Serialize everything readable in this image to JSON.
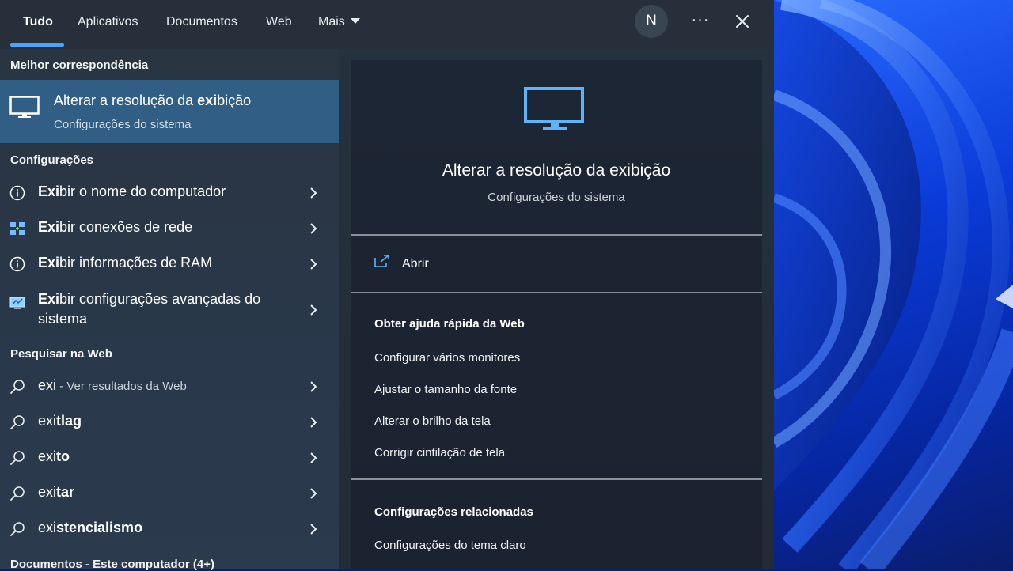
{
  "tabs": [
    {
      "label": "Tudo"
    },
    {
      "label": "Aplicativos"
    },
    {
      "label": "Documentos"
    },
    {
      "label": "Web"
    },
    {
      "label": "Mais"
    }
  ],
  "avatar_initial": "N",
  "more_label": "···",
  "sections": {
    "best_match": "Melhor correspondência",
    "settings": "Configurações",
    "web_search": "Pesquisar na Web",
    "documents": "Documentos - Este computador (4+)"
  },
  "best_match": {
    "title_pre": "Alterar a resolução da ",
    "title_bold": "exi",
    "title_post": "bição",
    "subtitle": "Configurações do sistema"
  },
  "settings_items": [
    {
      "bold": "Exi",
      "rest": "bir o nome do computador",
      "icon": "info-icon"
    },
    {
      "bold": "Exi",
      "rest": "bir conexões de rede",
      "icon": "network-icon"
    },
    {
      "bold": "Exi",
      "rest": "bir informações de RAM",
      "icon": "info-icon"
    },
    {
      "bold": "Exi",
      "rest": "bir configurações avançadas do sistema",
      "icon": "computer-icon"
    }
  ],
  "web_items": [
    {
      "pre": "exi",
      "bold": "",
      "muted": " - Ver resultados da Web"
    },
    {
      "pre": "exi",
      "bold": "tlag",
      "muted": ""
    },
    {
      "pre": "exi",
      "bold": "to",
      "muted": ""
    },
    {
      "pre": "exi",
      "bold": "tar",
      "muted": ""
    },
    {
      "pre": "exi",
      "bold": "stencialismo",
      "muted": ""
    }
  ],
  "detail": {
    "title": "Alterar a resolução da exibição",
    "subtitle": "Configurações do sistema",
    "open_label": "Abrir",
    "help_heading": "Obter ajuda rápida da Web",
    "help_links": [
      "Configurar vários monitores",
      "Ajustar o tamanho da fonte",
      "Alterar o brilho da tela",
      "Corrigir cintilação de tela"
    ],
    "related_heading": "Configurações relacionadas",
    "related_links": [
      "Configurações do tema claro"
    ]
  },
  "colors": {
    "accent": "#4aa3ff",
    "selected_row": "#315e84",
    "panel_bg": "#26323f",
    "detail_bg": "#1d2634"
  }
}
